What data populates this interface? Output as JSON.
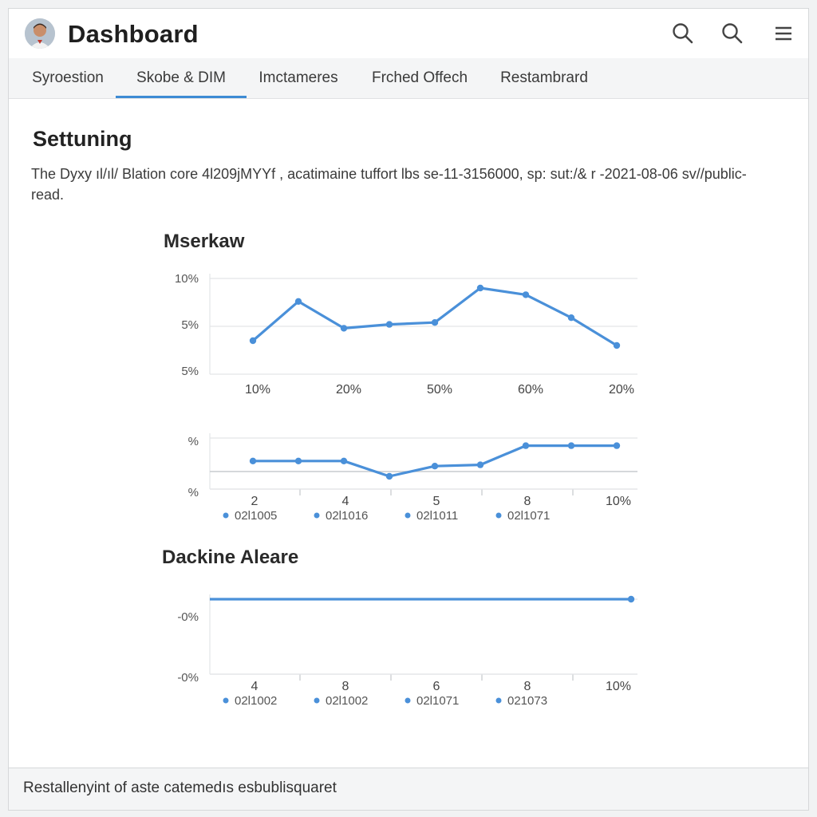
{
  "header": {
    "title": "Dashboard",
    "icons": [
      "avatar",
      "search-icon",
      "search-icon",
      "menu-icon"
    ]
  },
  "tabs": [
    {
      "label": "Syroestion",
      "active": false
    },
    {
      "label": "Skobe & DIM",
      "active": true
    },
    {
      "label": "Imctameres",
      "active": false
    },
    {
      "label": "Frched Offech",
      "active": false
    },
    {
      "label": "Restambrard",
      "active": false
    }
  ],
  "section": {
    "title": "Settuning",
    "description": "The Dyxy ıl/ıl/ Blation core 4l209jMYYf , acatimaine tuffort lbs se-11-3156000, sp: sut:/& r -2021-08-06 sv//public-read."
  },
  "colors": {
    "accent": "#3d8bd4",
    "line": "#4a90d9",
    "grid": "#e3e5e7"
  },
  "chart_data": [
    {
      "type": "line",
      "title": "Mserkaw",
      "y_ticks": [
        "10%",
        "5%",
        "5%"
      ],
      "x_ticks": [
        "10%",
        "20%",
        "50%",
        "60%",
        "20%"
      ],
      "series": [
        {
          "values": [
            4.5,
            8.6,
            5.8,
            6.2,
            6.4,
            10.0,
            9.3,
            6.9,
            4.0
          ]
        }
      ],
      "ylim": [
        1.0,
        11.0
      ],
      "grid": true
    },
    {
      "type": "line",
      "title": "",
      "y_ticks": [
        "%",
        "%"
      ],
      "x_ticks": [
        "2",
        "4",
        "5",
        "8",
        "10%"
      ],
      "legend": [
        "02l1005",
        "02l1016",
        "02l1011",
        "02l1071"
      ],
      "series": [
        {
          "values": [
            3.2,
            3.2,
            3.2,
            2.0,
            2.8,
            2.9,
            4.4,
            4.4,
            4.4
          ]
        }
      ],
      "ylim": [
        1.0,
        5.0
      ],
      "grid": true
    },
    {
      "type": "line",
      "title": "Dackine Aleare",
      "y_ticks": [
        "-0%",
        "-0%"
      ],
      "x_ticks": [
        "4",
        "8",
        "6",
        "8",
        "10%"
      ],
      "legend": [
        "02l1002",
        "02l1002",
        "02l1071",
        "021073"
      ],
      "series": [
        {
          "values": [
            5.0,
            5.0
          ]
        }
      ],
      "ylim": [
        0.0,
        5.0
      ],
      "grid": true
    }
  ],
  "footer": {
    "text": "Restallenyint of aste catemedıs esbublisquaret"
  }
}
